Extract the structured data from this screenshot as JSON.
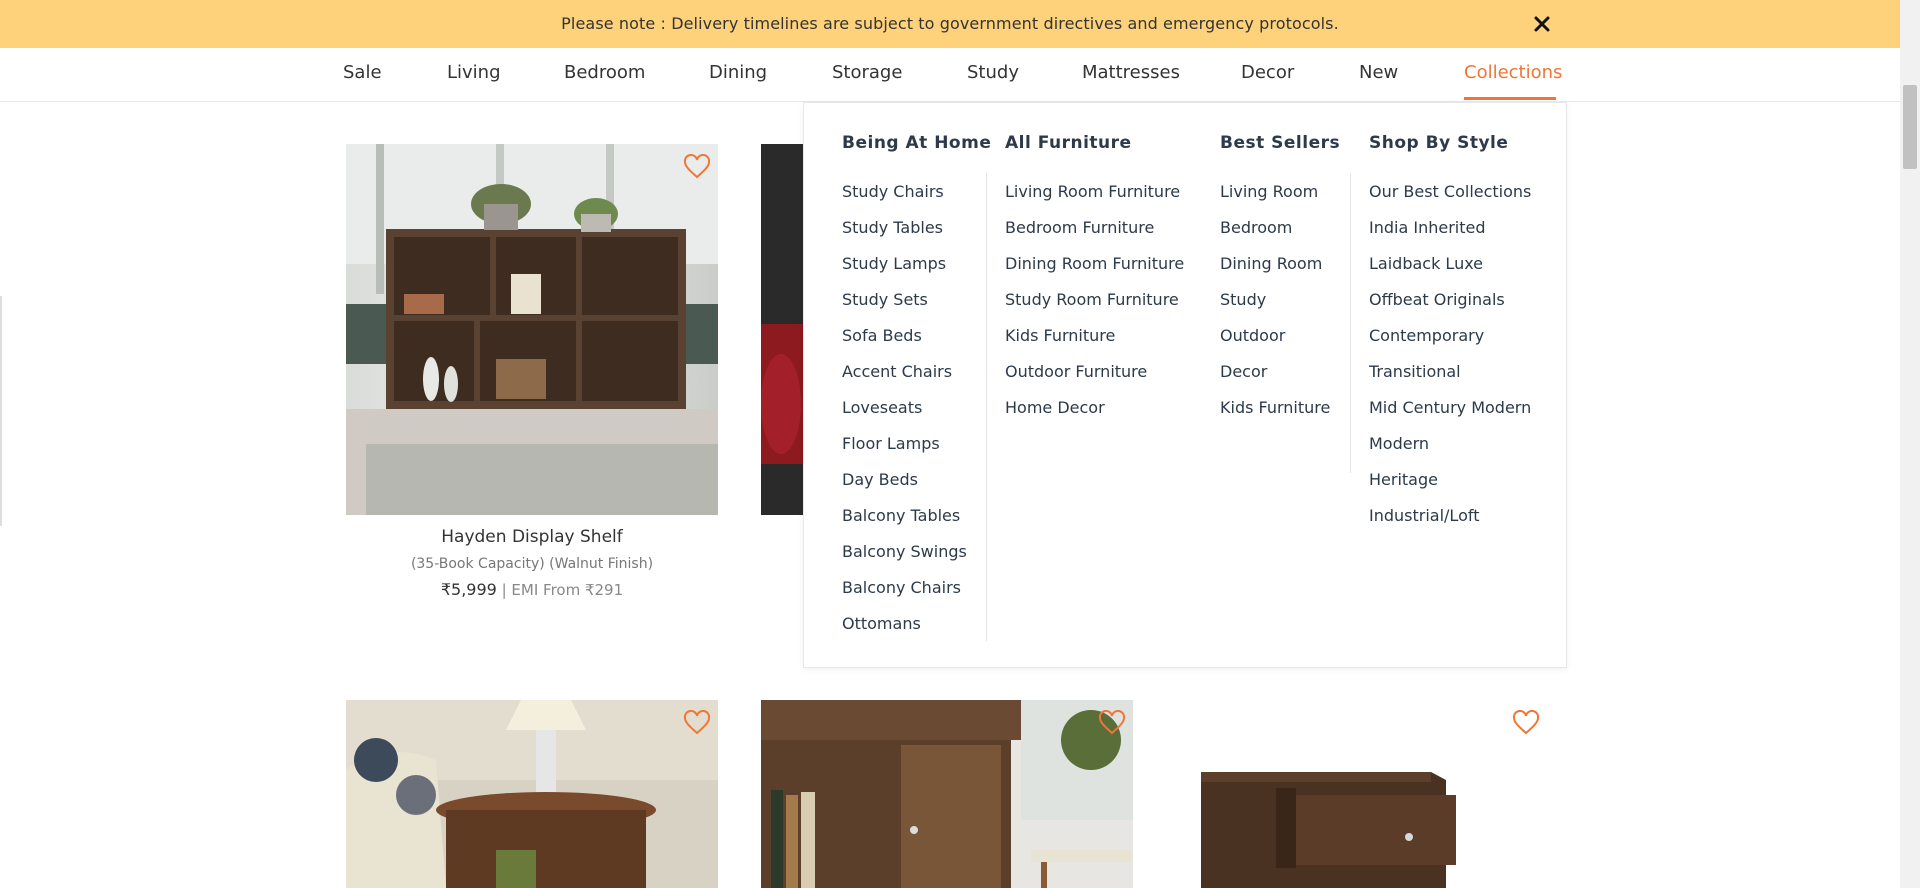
{
  "notice": {
    "text": "Please note : Delivery timelines are subject to government directives and emergency protocols.",
    "close_icon": "close-icon"
  },
  "nav": {
    "items": [
      "Sale",
      "Living",
      "Bedroom",
      "Dining",
      "Storage",
      "Study",
      "Mattresses",
      "Decor",
      "New",
      "Collections"
    ],
    "active": "Collections",
    "accent": "#f27535"
  },
  "products": [
    {
      "title": "Hayden Display Shelf",
      "subtitle": "(35-Book Capacity) (Walnut Finish)",
      "price": "₹5,999",
      "emi": " | EMI From ₹291"
    }
  ],
  "mega_menu": {
    "columns": [
      {
        "title": "Being At Home",
        "links": [
          "Study Chairs",
          "Study Tables",
          "Study Lamps",
          "Study Sets",
          "Sofa Beds",
          "Accent Chairs",
          "Loveseats",
          "Floor Lamps",
          "Day Beds",
          "Balcony Tables",
          "Balcony Swings",
          "Balcony Chairs",
          "Ottomans"
        ]
      },
      {
        "title": "All Furniture",
        "links": [
          "Living Room Furniture",
          "Bedroom Furniture",
          "Dining Room Furniture",
          "Study Room Furniture",
          "Kids Furniture",
          "Outdoor Furniture",
          "Home Decor"
        ]
      },
      {
        "title": "Best Sellers",
        "links": [
          "Living Room",
          "Bedroom",
          "Dining Room",
          "Study",
          "Outdoor",
          "Decor",
          "Kids Furniture"
        ]
      },
      {
        "title": "Shop By Style",
        "links": [
          "Our Best Collections",
          "India Inherited",
          "Laidback Luxe",
          "Offbeat Originals",
          "Contemporary",
          "Transitional",
          "Mid Century Modern",
          "Modern",
          "Heritage",
          "Industrial/Loft"
        ]
      }
    ]
  },
  "colors": {
    "notice_bg": "#fdd27b",
    "heart": "#f27535",
    "menu_text": "#2d3a4a"
  }
}
